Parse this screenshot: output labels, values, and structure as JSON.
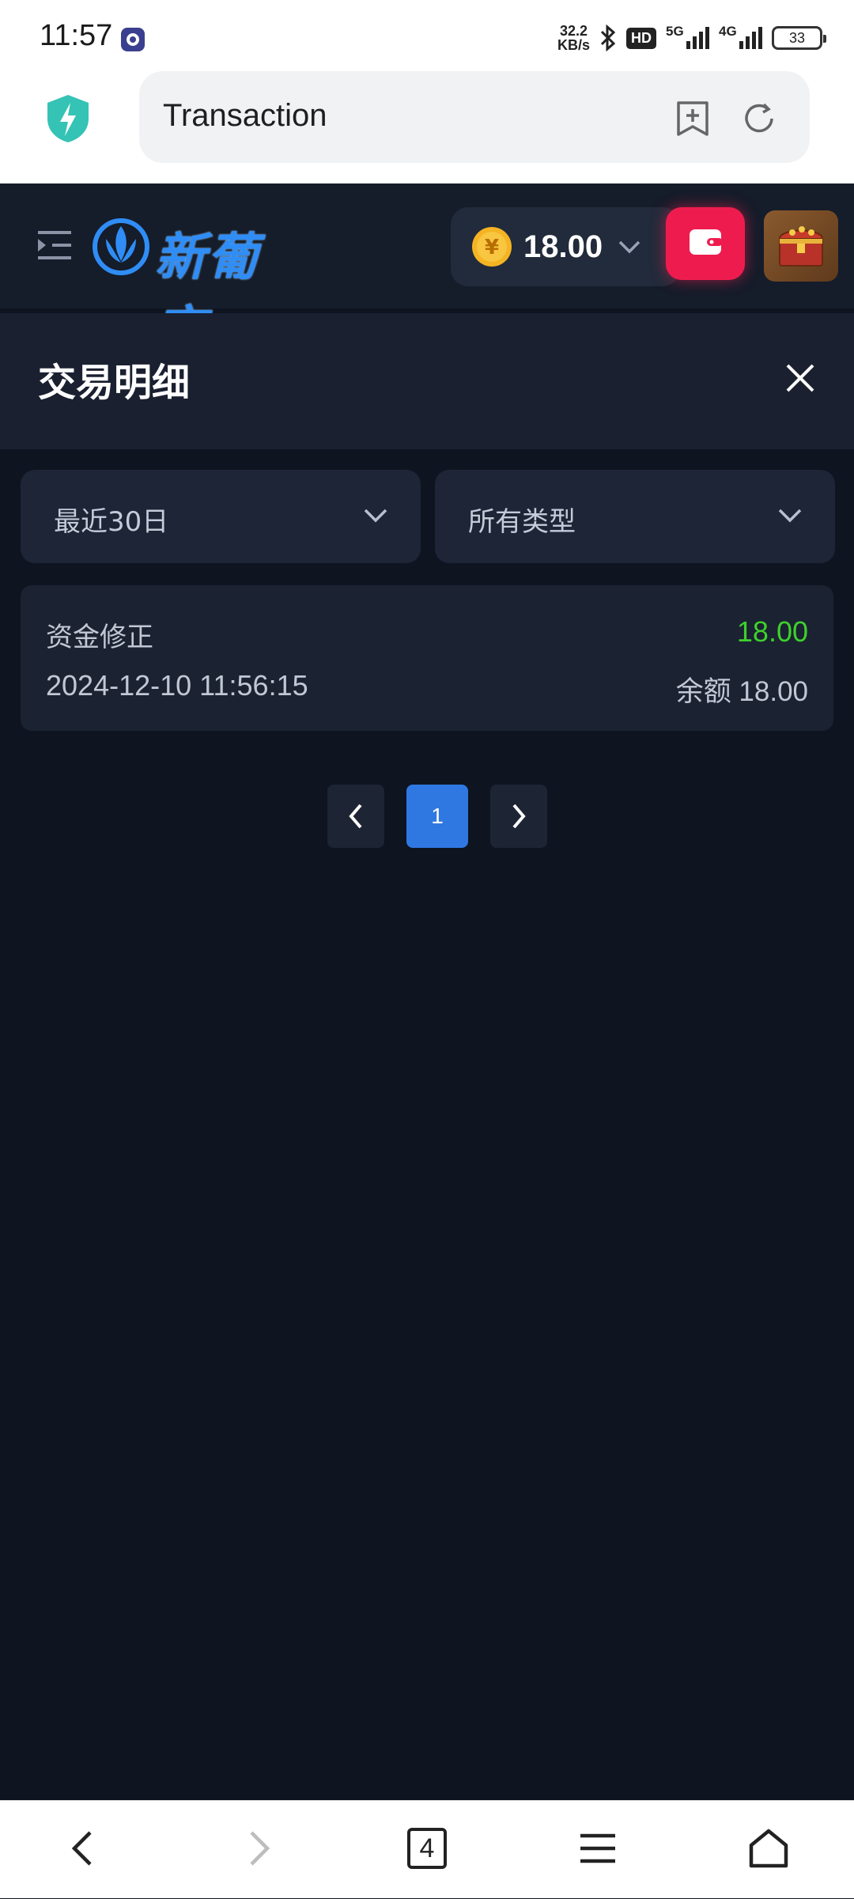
{
  "status_bar": {
    "time": "11:57",
    "net_speed_top": "32.2",
    "net_speed_bottom": "KB/s",
    "hd_label": "HD",
    "signal1_label": "5G",
    "signal2_label": "4G",
    "battery": "33"
  },
  "browser": {
    "url_text": "Transaction"
  },
  "header": {
    "logo_text": "新葡京",
    "balance": "18.00",
    "coin_symbol": "¥"
  },
  "panel": {
    "title": "交易明细"
  },
  "filters": {
    "date_range": "最近30日",
    "type": "所有类型"
  },
  "transactions": [
    {
      "type": "资金修正",
      "amount": "18.00",
      "datetime": "2024-12-10 11:56:15",
      "balance": "余额 18.00"
    }
  ],
  "pagination": {
    "current_page": "1"
  },
  "bottom_nav": {
    "tab_count": "4"
  },
  "colors": {
    "page_bg": "#0e1420",
    "accent_blue": "#2f78e2",
    "amount_green": "#3ed12b",
    "wallet_red": "#ee1c4e"
  }
}
